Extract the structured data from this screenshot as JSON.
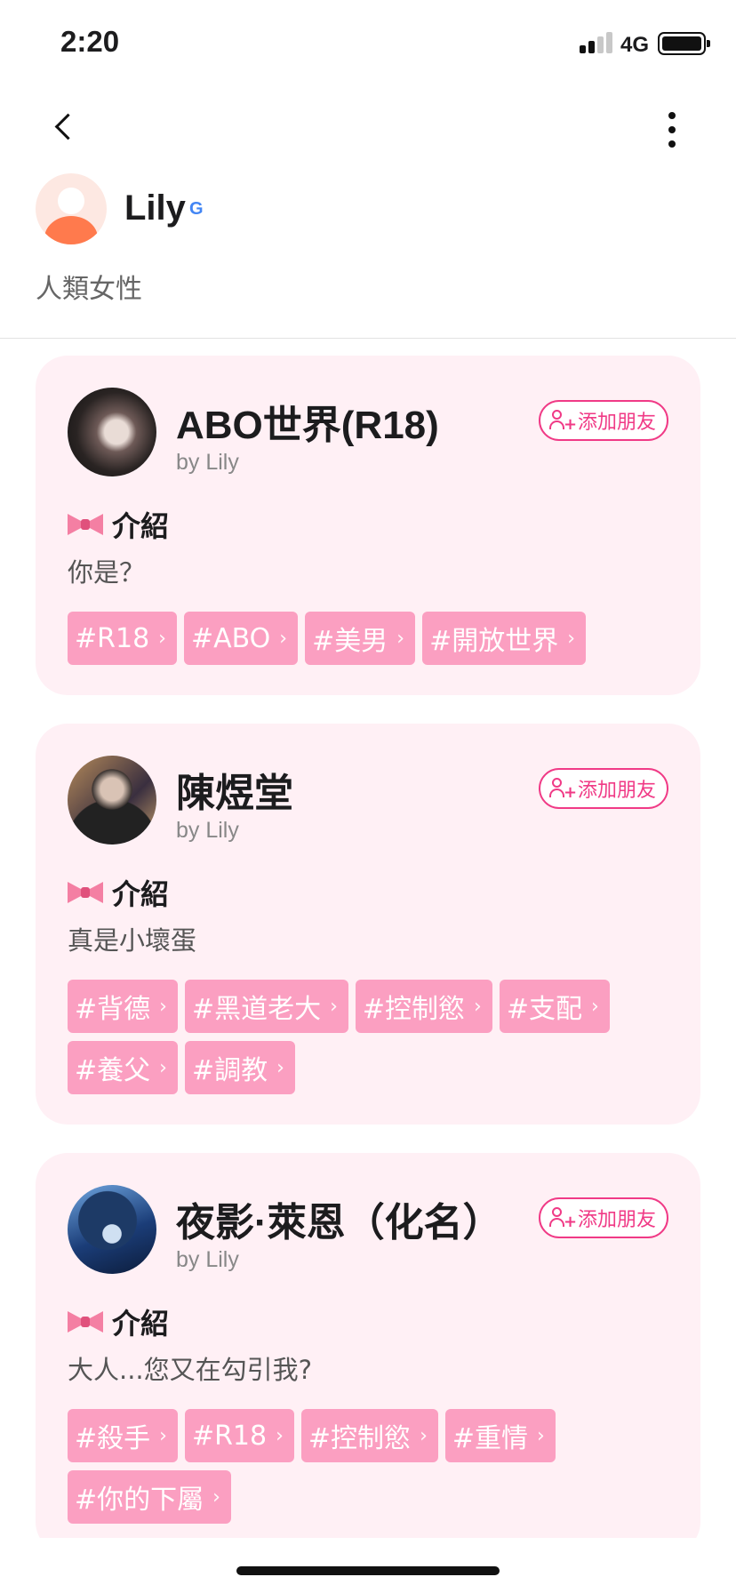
{
  "status_bar": {
    "time": "2:20",
    "network": "4G"
  },
  "profile": {
    "name": "Lily",
    "badge_letter": "G",
    "description": "人類女性"
  },
  "cards": [
    {
      "name": "ABO世界(R18)",
      "author": "by Lily",
      "add_friend": "添加朋友",
      "intro_label": "介紹",
      "intro": "你是？",
      "tags": [
        {
          "label": "#R18"
        },
        {
          "label": "#ABO"
        },
        {
          "label": "#美男"
        },
        {
          "label": "#開放世界"
        }
      ]
    },
    {
      "name": "陳煜堂",
      "author": "by Lily",
      "add_friend": "添加朋友",
      "intro_label": "介紹",
      "intro": "真是小壞蛋",
      "tags": [
        {
          "label": "#背德"
        },
        {
          "label": "#黑道老大"
        },
        {
          "label": "#控制慾"
        },
        {
          "label": "#支配"
        },
        {
          "label": "#養父"
        },
        {
          "label": "#調教"
        }
      ]
    },
    {
      "name": "夜影·萊恩（化名）",
      "author": "by Lily",
      "add_friend": "添加朋友",
      "intro_label": "介紹",
      "intro": "大人...您又在勾引我?",
      "tags": [
        {
          "label": "#殺手"
        },
        {
          "label": "#R18"
        },
        {
          "label": "#控制慾"
        },
        {
          "label": "#重情"
        },
        {
          "label": "#你的下屬"
        }
      ]
    }
  ],
  "colors": {
    "accent": "#f03a86",
    "card_background": "#fff0f5",
    "tag_background": "#fb9fc1",
    "avatar_orange": "#ff7a4d"
  },
  "icons": [
    "back-arrow-icon",
    "more-vertical-icon",
    "google-icon",
    "add-friend-icon",
    "bow-icon",
    "chevron-right-icon",
    "signal-icon",
    "battery-icon"
  ]
}
